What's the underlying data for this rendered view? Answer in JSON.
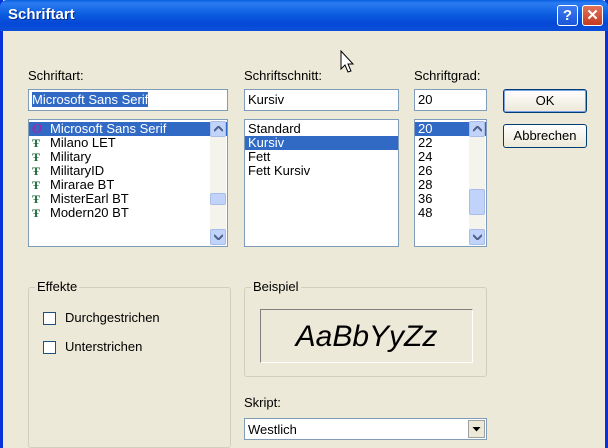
{
  "dialog": {
    "title": "Schriftart",
    "help_label": "?",
    "close_label": "✕"
  },
  "font": {
    "label": "Schriftart:",
    "value": "Microsoft Sans Serif",
    "items": [
      {
        "icon": "O",
        "name": "Microsoft Sans Serif"
      },
      {
        "icon": "TT",
        "name": "Milano LET"
      },
      {
        "icon": "TT",
        "name": "Military"
      },
      {
        "icon": "TT",
        "name": "MilitaryID"
      },
      {
        "icon": "TT",
        "name": "Mirarae BT"
      },
      {
        "icon": "TT",
        "name": "MisterEarl BT"
      },
      {
        "icon": "TT",
        "name": "Modern20 BT"
      }
    ]
  },
  "style": {
    "label": "Schriftschnitt:",
    "value": "Kursiv",
    "items": [
      "Standard",
      "Kursiv",
      "Fett",
      "Fett Kursiv"
    ]
  },
  "size": {
    "label": "Schriftgrad:",
    "value": "20",
    "items": [
      "20",
      "22",
      "24",
      "26",
      "28",
      "36",
      "48"
    ]
  },
  "buttons": {
    "ok": "OK",
    "cancel": "Abbrechen"
  },
  "effects": {
    "label": "Effekte",
    "strikeout": "Durchgestrichen",
    "underline": "Unterstrichen"
  },
  "sample": {
    "label": "Beispiel",
    "text": "AaBbYyZz"
  },
  "script": {
    "label": "Skript:",
    "value": "Westlich"
  }
}
